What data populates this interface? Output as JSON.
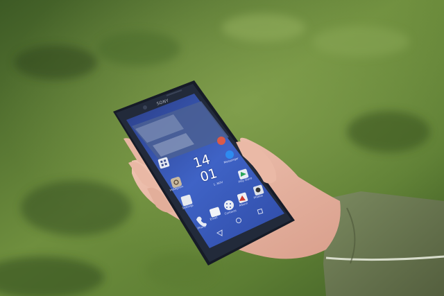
{
  "scene": {
    "description_colors": {
      "grass_dark": "#3a5422",
      "grass_light": "#7c9a4a",
      "phone_body": "#1c2230",
      "screen_blue": "#3c58b8",
      "skin": "#e8b9a6",
      "jacket": "#6b7a52"
    }
  },
  "phone": {
    "brand": "SONY",
    "clock_hour": "14",
    "clock_minute": "01",
    "date": "1. NOV",
    "apps": {
      "instagram": "Instagram",
      "messenger": "Messenger",
      "photos": "Photos",
      "play_store": "Play Store",
      "settings": "Settings",
      "contacts": "Contacts",
      "email": "Email",
      "phone": "Phone",
      "album": "Album",
      "apps": "Apps"
    }
  }
}
